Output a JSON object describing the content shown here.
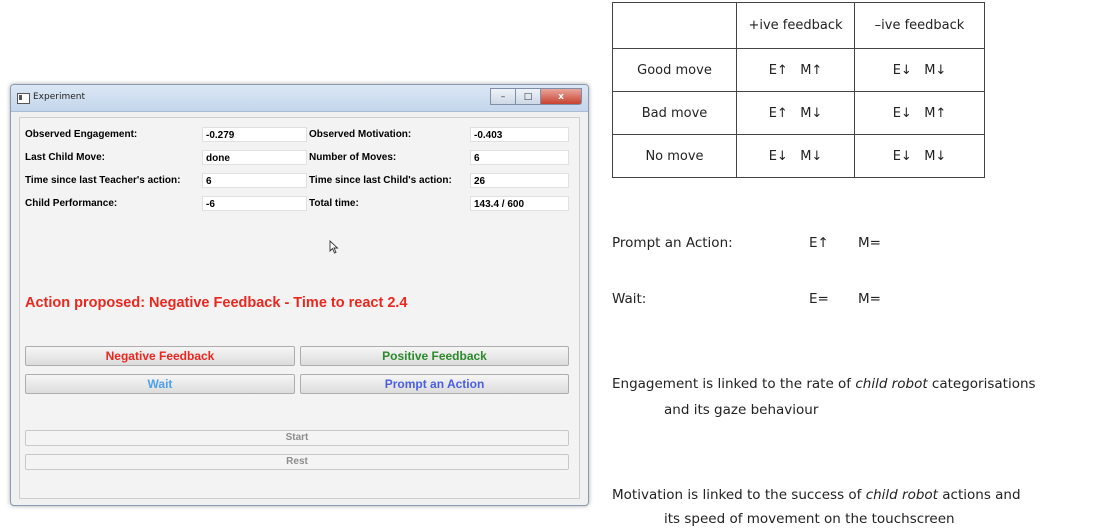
{
  "window": {
    "title": "Experiment",
    "caption_buttons": [
      "–",
      "□",
      "x"
    ]
  },
  "info": {
    "observed_engagement_label": "Observed Engagement:",
    "observed_engagement_value": "-0.279",
    "observed_motivation_label": "Observed Motivation:",
    "observed_motivation_value": "-0.403",
    "last_child_move_label": "Last Child Move:",
    "last_child_move_value": "done",
    "number_of_moves_label": "Number of Moves:",
    "number_of_moves_value": "6",
    "time_since_teacher_label": "Time since last Teacher's action:",
    "time_since_teacher_value": "6",
    "time_since_child_label": "Time since last Child's action:",
    "time_since_child_value": "26",
    "child_performance_label": "Child Performance:",
    "child_performance_value": "-6",
    "total_time_label": "Total time:",
    "total_time_value": "143.4 / 600"
  },
  "action_proposed": "Action proposed: Negative Feedback - Time to react 2.4",
  "buttons": {
    "negative_feedback": "Negative Feedback",
    "positive_feedback": "Positive Feedback",
    "wait": "Wait",
    "prompt_action": "Prompt an Action",
    "start": "Start",
    "rest": "Rest"
  },
  "colors": {
    "negative": "#e8281f",
    "positive": "#2b8a2b",
    "wait": "#4da0e8",
    "prompt": "#4a5ee0"
  },
  "feedback_table": {
    "headers": [
      "",
      "+ive feedback",
      "–ive feedback"
    ],
    "rows": [
      [
        "Good move",
        "E↑   M↑",
        "E↓   M↓"
      ],
      [
        "Bad move",
        "E↑   M↓",
        "E↓   M↑"
      ],
      [
        "No move",
        "E↓   M↓",
        "E↓   M↓"
      ]
    ]
  },
  "prompt_line": {
    "label": "Prompt an Action:",
    "e": "E↑",
    "m": "M="
  },
  "wait_line": {
    "label": "Wait:",
    "e": "E=",
    "m": "M="
  },
  "engagement_note": {
    "line1_pre": "Engagement is linked to the rate of ",
    "line1_italic": "child robot",
    "line1_post": " categorisations",
    "line2": "and its gaze behaviour"
  },
  "motivation_note": {
    "line1_pre": "Motivation is linked to the success of ",
    "line1_italic": "child robot",
    "line1_post": " actions and",
    "line2": "its speed of movement on the touchscreen"
  }
}
